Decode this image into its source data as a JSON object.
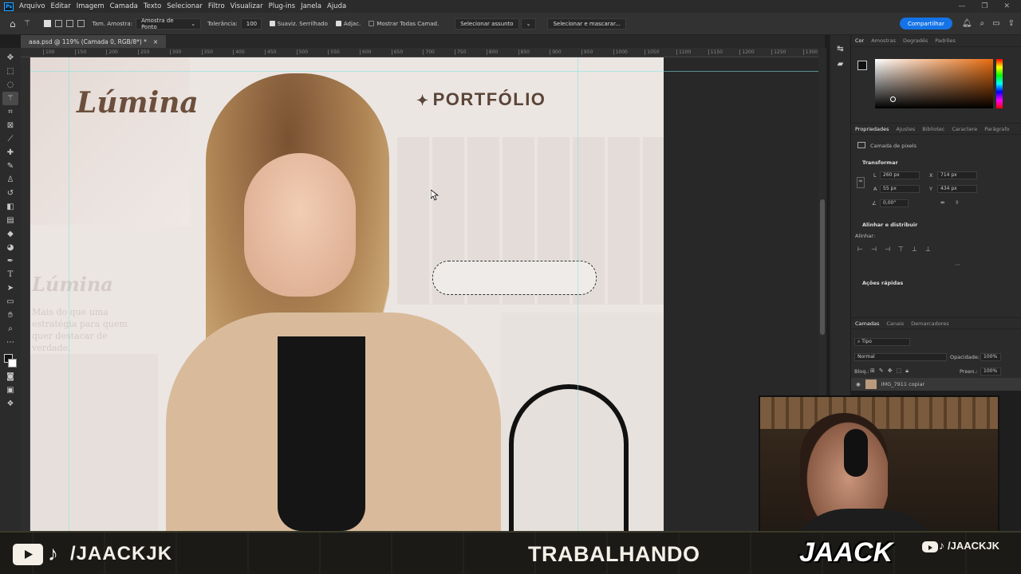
{
  "app": {
    "logo": "Ps"
  },
  "menu": [
    "Arquivo",
    "Editar",
    "Imagem",
    "Camada",
    "Texto",
    "Selecionar",
    "Filtro",
    "Visualizar",
    "Plug-ins",
    "Janela",
    "Ajuda"
  ],
  "options": {
    "sample_label": "Tam. Amostra:",
    "sample_value": "Amostra de Ponto",
    "tolerance_label": "Tolerância:",
    "tolerance_value": "100",
    "antialias": "Suaviz. Serrilhado",
    "contiguous": "Adjac.",
    "all_layers": "Mostrar Todas Camad.",
    "select_subject": "Selecionar assunto",
    "select_mask": "Selecionar e mascarar...",
    "share": "Compartilhar"
  },
  "document": {
    "tab_title": "aaa.psd @ 119% (Camada 0, RGB/8*) *",
    "close": "×"
  },
  "ruler": [
    "100",
    "150",
    "200",
    "250",
    "300",
    "350",
    "400",
    "450",
    "500",
    "550",
    "600",
    "650",
    "700",
    "750",
    "800",
    "850",
    "900",
    "950",
    "1000",
    "1050",
    "1100",
    "1150",
    "1200",
    "1250",
    "1300"
  ],
  "canvas": {
    "brand": "Lúmina",
    "title": "PORTFÓLIO",
    "ghost_brand": "Lúmina",
    "ghost_text": "Mais do que uma estratégia para quem quer destacar de verdade."
  },
  "color_panel": {
    "tabs": [
      "Cor",
      "Amostras",
      "Degradês",
      "Padrões"
    ]
  },
  "properties": {
    "tabs": [
      "Propriedades",
      "Ajustes",
      "Bibliotec",
      "Caractere",
      "Parágrafo"
    ],
    "layer_type": "Camada de pixels",
    "transform_title": "Transformar",
    "w_label": "L",
    "w": "260 px",
    "x_label": "X",
    "x": "714 px",
    "h_label": "A",
    "h": "55 px",
    "y_label": "Y",
    "y": "434 px",
    "angle": "0,00°",
    "align_title": "Alinhar e distribuir",
    "align_label": "Alinhar:",
    "quick_title": "Ações rápidas"
  },
  "layers": {
    "tabs": [
      "Camadas",
      "Canais",
      "Demarcadores"
    ],
    "filter": "Tipo",
    "blend": "Normal",
    "opacity_label": "Opacidade:",
    "opacity": "100%",
    "lock_label": "Bloq.:",
    "fill_label": "Preen.:",
    "fill": "100%",
    "layer_name": "IMG_7911 copiar"
  },
  "overlay": {
    "handle_left": "/JAACKJK",
    "status": "TRABALHANDO",
    "logo": "JAACK",
    "handle_right": "/JAACKJK"
  }
}
